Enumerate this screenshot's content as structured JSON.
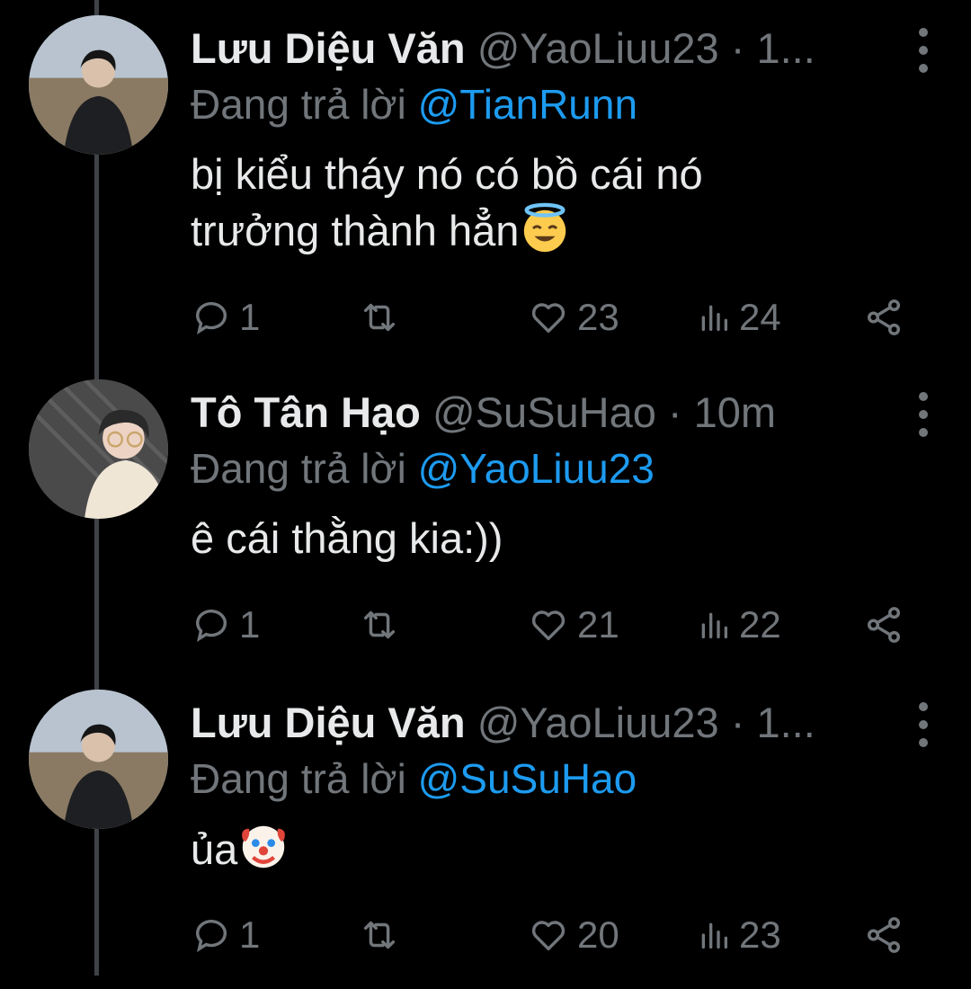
{
  "tweets": [
    {
      "name": "Lưu Diệu Văn",
      "meta": "@YaoLiuu23 · 1...",
      "reply_prefix": "Đang trả lời",
      "reply_handle": "@TianRunn",
      "text_line1": "bị kiểu tháy nó có bồ cái nó",
      "text_line2": "trưởng thành hẳn",
      "emoji": "smiling-face-with-halo",
      "replies": "1",
      "likes": "23",
      "views": "24"
    },
    {
      "name": "Tô Tân Hạo",
      "meta": "@SuSuHao · 10m",
      "reply_prefix": "Đang trả lời",
      "reply_handle": "@YaoLiuu23",
      "text_line1": "ê cái thằng kia:))",
      "replies": "1",
      "likes": "21",
      "views": "22"
    },
    {
      "name": "Lưu Diệu Văn",
      "meta": "@YaoLiuu23 · 1...",
      "reply_prefix": "Đang trả lời",
      "reply_handle": "@SuSuHao",
      "text_line1": "ủa",
      "emoji": "clown-face",
      "replies": "1",
      "likes": "20",
      "views": "23"
    }
  ],
  "colors": {
    "background": "#000000",
    "text": "#e7e9ea",
    "muted": "#71767b",
    "link": "#1d9bf0",
    "thread_line": "#3f4347"
  },
  "icons": [
    "reply-icon",
    "retweet-icon",
    "like-icon",
    "views-icon",
    "share-icon",
    "more-icon"
  ]
}
